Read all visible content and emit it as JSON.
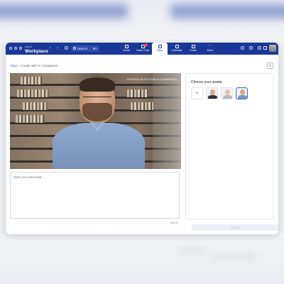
{
  "app": {
    "brand_small": "zoom",
    "brand_name": "Workplace"
  },
  "search": {
    "label": "Search",
    "shortcut": "⌘F"
  },
  "nav": {
    "items": [
      {
        "label": "Home",
        "icon": "home-icon"
      },
      {
        "label": "Team Chat",
        "icon": "chat-icon"
      },
      {
        "label": "Clips",
        "icon": "clips-icon"
      },
      {
        "label": "Calendar",
        "icon": "calendar-icon"
      },
      {
        "label": "Email",
        "icon": "mail-icon"
      },
      {
        "label": "More",
        "icon": "more-icon"
      }
    ],
    "active": "Clips"
  },
  "breadcrumb": {
    "root": "Clips",
    "separator": ">",
    "current": "Create with AI Companion"
  },
  "video": {
    "watermark": "CREATED WITH ZOOM AI COMPANION"
  },
  "transcript": {
    "placeholder": "Start your transcript...",
    "counter": "0/5000"
  },
  "avatar_panel": {
    "title": "Choose your avatar",
    "add_label": "+",
    "selected_index": 3
  },
  "actions": {
    "create_label": "Create"
  },
  "colors": {
    "topbar": "#1a3897",
    "accent": "#2d6cdf"
  }
}
